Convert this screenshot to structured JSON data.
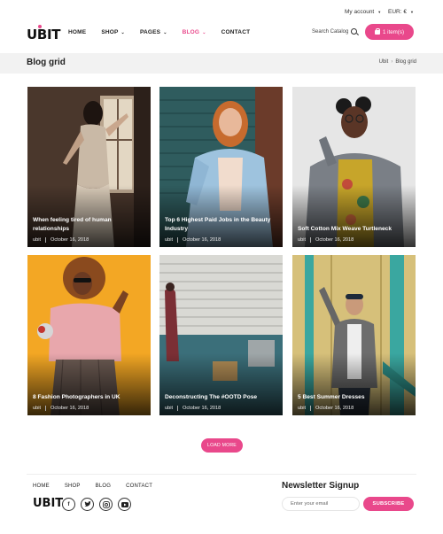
{
  "topbar": {
    "account_label": "My account",
    "currency_label": "EUR: €"
  },
  "header": {
    "logo": "UBIT",
    "nav": [
      "HOME",
      "SHOP",
      "PAGES",
      "BLOG",
      "CONTACT"
    ],
    "active_nav": "BLOG",
    "search_label": "Search Catalog",
    "cart_label": "1 item(s)"
  },
  "page": {
    "title": "Blog grid",
    "breadcrumb": [
      "Ubit",
      "Blog grid"
    ]
  },
  "posts": [
    {
      "title": "When feeling tired of human relationships",
      "author": "ubit",
      "date": "October 16, 2018"
    },
    {
      "title": "Top 6 Highest Paid Jobs in the Beauty Industry",
      "author": "ubit",
      "date": "October 16, 2018"
    },
    {
      "title": "Soft Cotton Mix Weave Turtleneck",
      "author": "ubit",
      "date": "October 16, 2018"
    },
    {
      "title": "8 Fashion Photographers in UK",
      "author": "ubit",
      "date": "October 16, 2018"
    },
    {
      "title": "Deconstructing The #OOTD Pose",
      "author": "ubit",
      "date": "October 16, 2018"
    },
    {
      "title": "5 Best Summer Dresses",
      "author": "ubit",
      "date": "October 16, 2018"
    }
  ],
  "load_more_label": "LOAD MORE",
  "footer": {
    "nav": [
      "HOME",
      "SHOP",
      "BLOG",
      "CONTACT"
    ],
    "logo": "UBIT",
    "social": [
      "facebook-icon",
      "twitter-icon",
      "instagram-icon",
      "youtube-icon"
    ],
    "newsletter_title": "Newsletter Signup",
    "email_placeholder": "Enter your email",
    "subscribe_label": "SUBSCRIBE"
  },
  "colors": {
    "accent": "#e9488b",
    "breadcrumb_bg": "#f2f2f2"
  }
}
